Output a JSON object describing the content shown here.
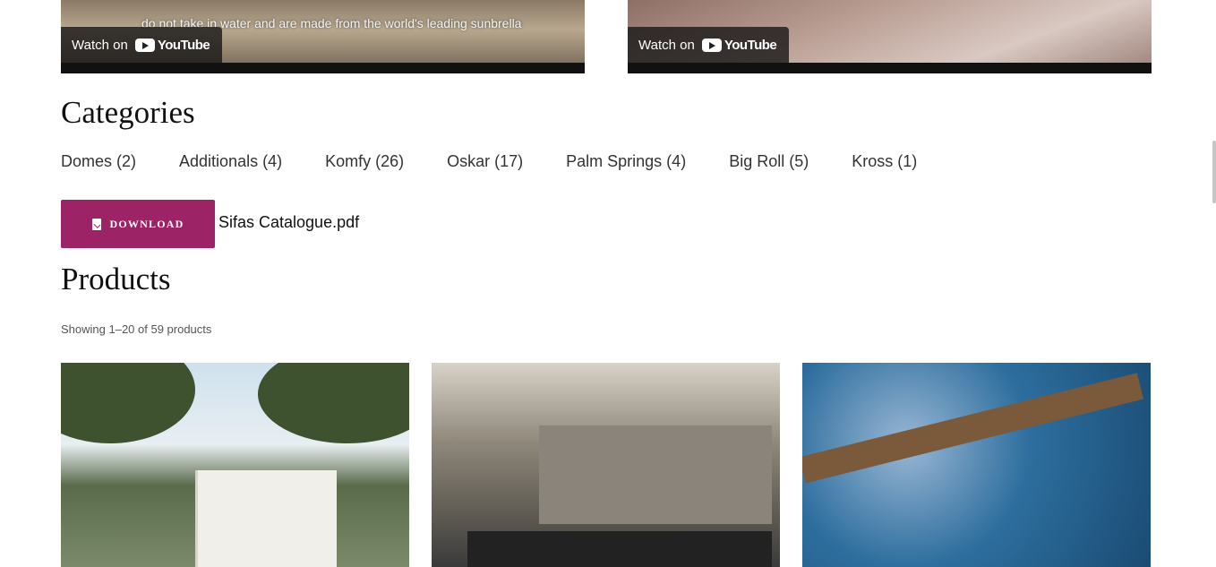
{
  "videos": [
    {
      "caption": "do not take in water and are made from the world's leading sunbrella",
      "watch_label": "Watch on",
      "yt_label": "YouTube"
    },
    {
      "caption": "",
      "watch_label": "Watch on",
      "yt_label": "YouTube"
    }
  ],
  "categories": {
    "heading": "Categories",
    "items": [
      "Domes (2)",
      "Additionals (4)",
      "Komfy (26)",
      "Oskar (17)",
      "Palm Springs (4)",
      "Big Roll (5)",
      "Kross (1)"
    ]
  },
  "download": {
    "button_label": "DOWNLOAD",
    "file_name": "Sifas Catalogue.pdf"
  },
  "products": {
    "heading": "Products",
    "result_count": "Showing 1–20 of 59 products"
  },
  "colors": {
    "accent": "#9b2366"
  },
  "icons": {
    "download": "file-download-icon",
    "youtube": "youtube-logo-icon"
  }
}
